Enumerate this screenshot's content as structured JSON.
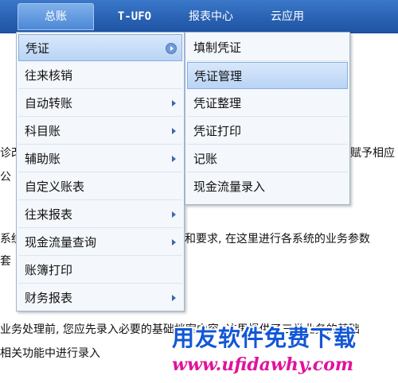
{
  "menubar": {
    "tabs": [
      {
        "label": "总账"
      },
      {
        "label": "T-UFO"
      },
      {
        "label": "报表中心"
      },
      {
        "label": "云应用"
      }
    ]
  },
  "background_text": {
    "line1_left": "诊改",
    "line1_right": "赋予相应",
    "line2": "公",
    "line3_left": "系统",
    "line3_right": "和要求, 在这里进行各系统的业务参数",
    "line4": "套",
    "line5": "业务处理前, 您应先录入必要的基础档案内容, 这里提供了三类业务的基础",
    "line6": "相关功能中进行录入"
  },
  "main_menu": {
    "items": [
      {
        "label": "凭证"
      },
      {
        "label": "往来核销"
      },
      {
        "label": "自动转账"
      },
      {
        "label": "科目账"
      },
      {
        "label": "辅助账"
      },
      {
        "label": "自定义账表"
      },
      {
        "label": "往来报表"
      },
      {
        "label": "现金流量查询"
      },
      {
        "label": "账簿打印"
      },
      {
        "label": "财务报表"
      }
    ]
  },
  "sub_menu": {
    "items": [
      {
        "label": "填制凭证"
      },
      {
        "label": "凭证管理"
      },
      {
        "label": "凭证整理"
      },
      {
        "label": "凭证打印"
      },
      {
        "label": "记账"
      },
      {
        "label": "现金流量录入"
      }
    ]
  },
  "watermark": {
    "title": "用友软件免费下载",
    "url": "www.ufidawhy.com"
  }
}
